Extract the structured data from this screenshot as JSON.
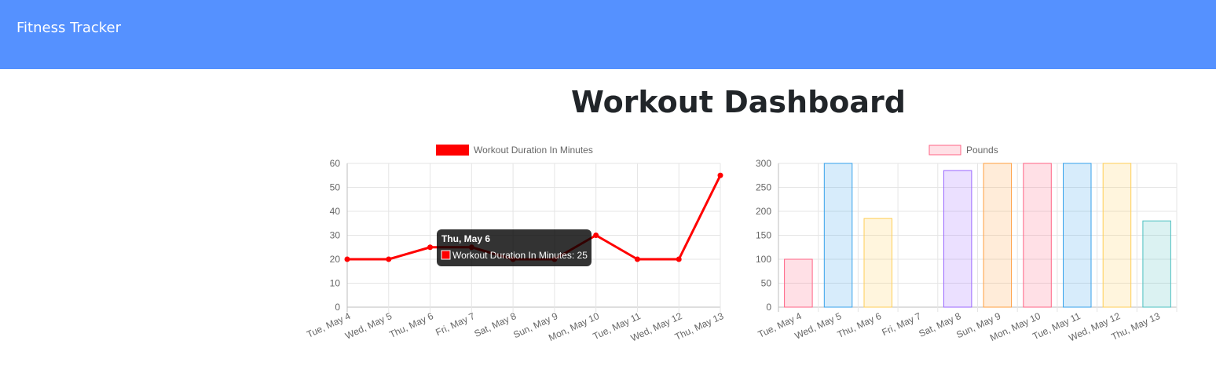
{
  "navbar": {
    "brand": "Fitness Tracker"
  },
  "page": {
    "title": "Workout Dashboard"
  },
  "colors": {
    "navbar": "#5591ff",
    "duration_line": "#ff0000"
  },
  "chart_data": [
    {
      "type": "line",
      "categories": [
        "Tue, May 4",
        "Wed, May 5",
        "Thu, May 6",
        "Fri, May 7",
        "Sat, May 8",
        "Sun, May 9",
        "Mon, May 10",
        "Tue, May 11",
        "Wed, May 12",
        "Thu, May 13"
      ],
      "series": [
        {
          "name": "Workout Duration In Minutes",
          "color": "#ff0000",
          "values": [
            20,
            20,
            25,
            25,
            20,
            20,
            30,
            20,
            20,
            55
          ]
        }
      ],
      "ylim": [
        0,
        60
      ],
      "yticks": [
        0,
        10,
        20,
        30,
        40,
        50,
        60
      ],
      "grid": true,
      "legend": "top-center",
      "tooltip": {
        "title": "Thu, May 6",
        "label": "Workout Duration In Minutes: 25"
      }
    },
    {
      "type": "bar",
      "categories": [
        "Tue, May 4",
        "Wed, May 5",
        "Thu, May 6",
        "Fri, May 7",
        "Sat, May 8",
        "Sun, May 9",
        "Mon, May 10",
        "Tue, May 11",
        "Wed, May 12",
        "Thu, May 13"
      ],
      "series": [
        {
          "name": "Pounds",
          "values": [
            100,
            300,
            185,
            0,
            285,
            300,
            300,
            300,
            300,
            180
          ]
        }
      ],
      "bar_colors": [
        "#ff6384",
        "#36a2eb",
        "#ffce56",
        "#4bc0c0",
        "#9966ff",
        "#ff9f40",
        "#ff6384",
        "#36a2eb",
        "#ffce56",
        "#4bc0c0"
      ],
      "ylim": [
        0,
        300
      ],
      "yticks": [
        0,
        50,
        100,
        150,
        200,
        250,
        300
      ],
      "grid": true,
      "legend": "top-center"
    }
  ]
}
